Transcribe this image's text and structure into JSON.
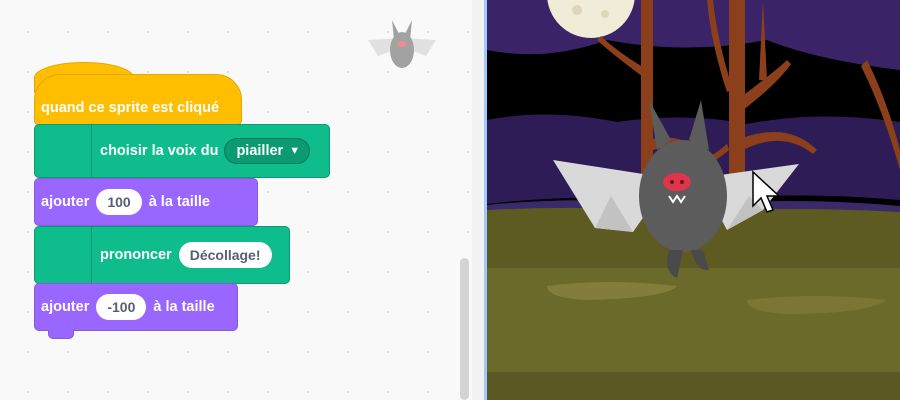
{
  "code_area": {
    "blocks": {
      "when_clicked": "quand ce sprite est cliqué",
      "set_voice": {
        "label": "choisir la voix du",
        "value": "piailler"
      },
      "change_size_1": {
        "prefix": "ajouter",
        "value": "100",
        "suffix": "à la taille"
      },
      "speak": {
        "label": "prononcer",
        "value": "Décollage!"
      },
      "change_size_2": {
        "prefix": "ajouter",
        "value": "-100",
        "suffix": "à la taille"
      }
    },
    "dropdown_icon": "triangle-down-icon",
    "sprite_thumbnail": "bat-icon"
  },
  "colors": {
    "events": "#ffbf00",
    "extension": "#0fbd8c",
    "looks": "#9966ff",
    "stage_sky": "#3a2366",
    "stage_ground": "#5d5a22"
  },
  "stage": {
    "sprite": "bat",
    "cursor": "mouse-pointer-icon"
  }
}
